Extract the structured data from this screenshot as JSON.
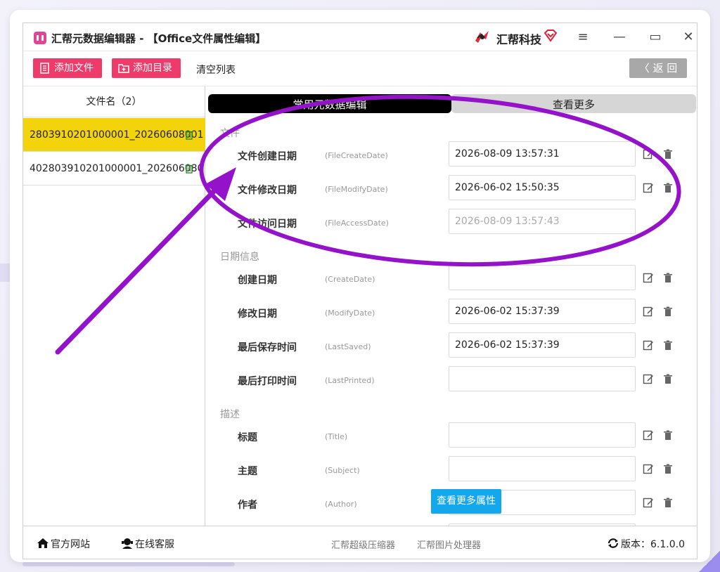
{
  "window": {
    "title": "汇帮元数据编辑器 - 【Office文件属性编辑】",
    "brand": "汇帮科技",
    "buttons": {
      "menu": "≡",
      "minimize": "—",
      "maximize": "▭",
      "close": "✕"
    }
  },
  "toolbar": {
    "add_file": "添加文件",
    "add_dir": "添加目录",
    "clear_list": "清空列表",
    "back": "〈 返 回"
  },
  "file_list": {
    "header": "文件名（2）",
    "files": [
      {
        "name": "2803910201000001_20260608001",
        "selected": true
      },
      {
        "name": "402803910201000001_202606080",
        "selected": false
      }
    ]
  },
  "tabs": {
    "common": "常用元数据编辑",
    "more": "查看更多"
  },
  "sections": {
    "file": "文件",
    "date": "日期信息",
    "desc": "描述"
  },
  "properties": {
    "file_create": {
      "label": "文件创建日期",
      "key": "(FileCreateDate)",
      "value": "2026-08-09 13:57:31"
    },
    "file_modify": {
      "label": "文件修改日期",
      "key": "(FileModifyDate)",
      "value": "2026-06-02 15:50:35"
    },
    "file_access": {
      "label": "文件访问日期",
      "key": "(FileAccessDate)",
      "value": "2026-08-09 13:57:43"
    },
    "create_date": {
      "label": "创建日期",
      "key": "(CreateDate)",
      "value": ""
    },
    "modify_date": {
      "label": "修改日期",
      "key": "(ModifyDate)",
      "value": "2026-06-02 15:37:39"
    },
    "last_saved": {
      "label": "最后保存时间",
      "key": "(LastSaved)",
      "value": "2026-06-02 15:37:39"
    },
    "last_printed": {
      "label": "最后打印时间",
      "key": "(LastPrinted)",
      "value": ""
    },
    "title": {
      "label": "标题",
      "key": "(Title)",
      "value": ""
    },
    "subject": {
      "label": "主题",
      "key": "(Subject)",
      "value": ""
    },
    "author": {
      "label": "作者",
      "key": "(Author)",
      "value": ""
    }
  },
  "more_properties_button": "查看更多属性",
  "statusbar": {
    "official_site": "官方网站",
    "online_service": "在线客服",
    "compressor": "汇帮超级压缩器",
    "image_tool": "汇帮图片处理器",
    "version": "版本：6.1.0.0"
  },
  "colors": {
    "accent_pink": "#ee3b6a",
    "selected_row": "#f2d30c",
    "more_button": "#13a7ec",
    "annotation": "#9412c9"
  }
}
